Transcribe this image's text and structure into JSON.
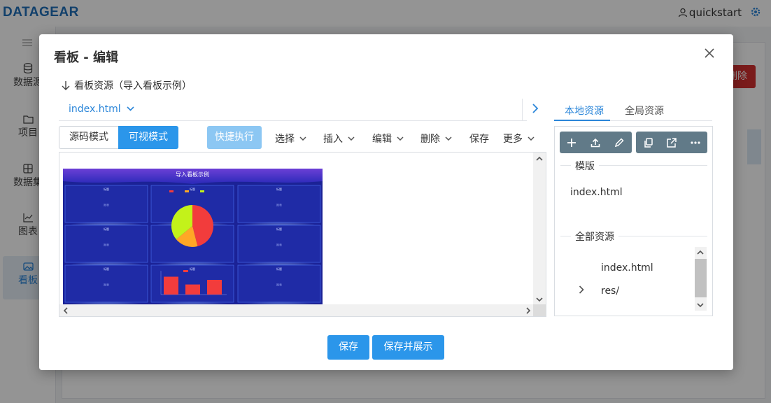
{
  "app": {
    "logo": "DATAGEAR",
    "user": "quickstart",
    "side_items": [
      "数据源",
      "项目",
      "数据集",
      "图表",
      "看板"
    ],
    "bg_delete_label": "删除"
  },
  "dialog": {
    "title": "看板 - 编辑",
    "section_title": "看板资源（导入看板示例）",
    "file_tab": "index.html",
    "modes": [
      "源码模式",
      "可视模式"
    ],
    "quick_exec": "快捷执行",
    "menus": [
      "选择",
      "插入",
      "编辑",
      "删除",
      "保存",
      "更多"
    ],
    "preview": {
      "title": "导入看板示例",
      "panel_label": "标题",
      "empty_label": "图表"
    },
    "right_tabs": [
      "本地资源",
      "全局资源"
    ],
    "template_label": "模版",
    "template_files": [
      "index.html"
    ],
    "all_resources_label": "全部资源",
    "all_resources": [
      "index.html",
      "res/"
    ],
    "save": "保存",
    "save_show": "保存并展示"
  },
  "colors": {
    "accent": "#2b96ea",
    "link": "#2b86d9",
    "toolbar": "#617a88",
    "danger": "#d32f2f",
    "preview_bg": "#1a1f9a"
  },
  "chart_data": [
    {
      "type": "pie",
      "title": "标题",
      "values": [
        46,
        18,
        36
      ],
      "colors": [
        "#f23c3c",
        "#ffa726",
        "#c3f21a"
      ]
    },
    {
      "type": "bar",
      "title": "标题",
      "categories": [
        "",
        "",
        ""
      ],
      "values": [
        85,
        48,
        70
      ],
      "colors": [
        "#f23c3c"
      ]
    }
  ]
}
